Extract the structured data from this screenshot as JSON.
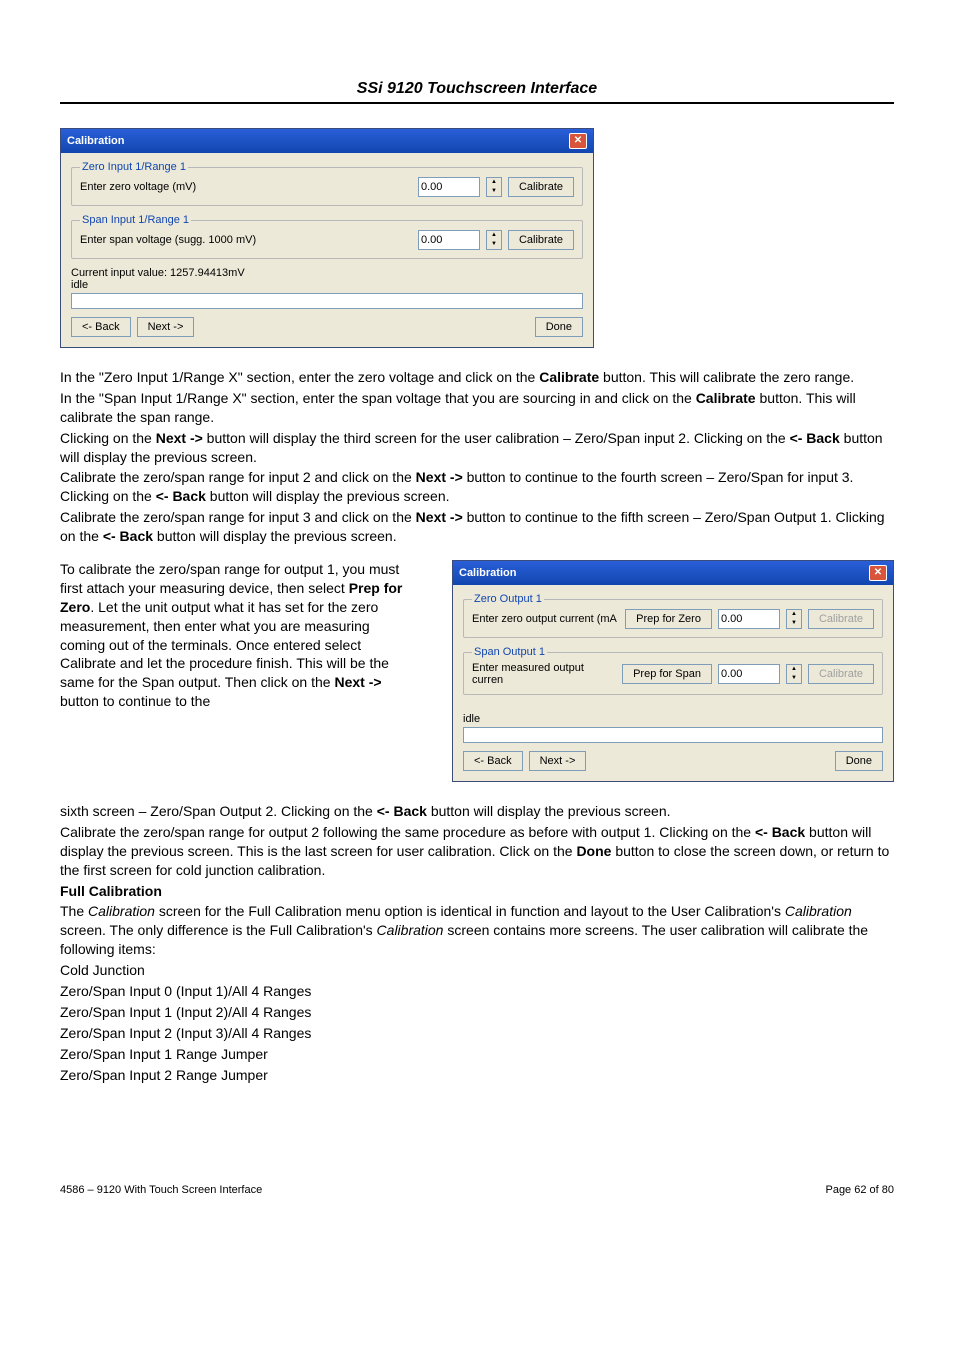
{
  "header": {
    "title": "SSi 9120 Touchscreen Interface"
  },
  "dlg1": {
    "title": "Calibration",
    "zero": {
      "legend": "Zero Input 1/Range 1",
      "label": "Enter zero voltage (mV)",
      "value": "0.00",
      "calibrate": "Calibrate"
    },
    "span": {
      "legend": "Span Input 1/Range 1",
      "label": "Enter span voltage (sugg. 1000 mV)",
      "value": "0.00",
      "calibrate": "Calibrate"
    },
    "current_value_line": "Current input value: 1257.94413mV",
    "idle": "idle",
    "back": "<- Back",
    "next": "Next ->",
    "done": "Done"
  },
  "para1": {
    "l1a": "In the \"Zero Input 1/Range X\" section, enter the zero voltage and click on the ",
    "l1b": "Calibrate",
    "l1c": " button. This will calibrate the zero range.",
    "l2a": "In the \"Span Input 1/Range X\" section, enter the span voltage that you are sourcing in and click on the ",
    "l2b": "Calibrate",
    "l2c": " button.  This will calibrate the span range.",
    "l3a": "Clicking on the ",
    "l3b": "Next ->",
    "l3c": " button will display the third screen for the user calibration – Zero/Span input 2.  Clicking on the ",
    "l3d": "<- Back",
    "l3e": " button will display the previous screen.",
    "l4a": "Calibrate the zero/span range for input 2 and click on the ",
    "l4b": "Next ->",
    "l4c": " button to continue to the fourth screen – Zero/Span for input 3.  Clicking on the ",
    "l4d": "<- Back",
    "l4e": " button will display the previous screen.",
    "l5a": "Calibrate the zero/span range for input 3 and click on the ",
    "l5b": "Next ->",
    "l5c": " button to continue to the fifth screen – Zero/Span Output 1.  Clicking on the ",
    "l5d": "<- Back",
    "l5e": " button will display the previous screen."
  },
  "left_col": {
    "t1": "To calibrate the zero/span range for output 1, you must first attach your measuring device, then select ",
    "t2": "Prep for Zero",
    "t3": ".  Let the unit output what it has set for the zero measurement, then enter what you are measuring coming out of the terminals. Once entered select Calibrate and let the procedure finish.  This will be the same for the Span output.  Then click on the ",
    "t4": "Next ->",
    "t5": " button to continue to the"
  },
  "dlg2": {
    "title": "Calibration",
    "zero": {
      "legend": "Zero Output 1",
      "label": "Enter zero output current (mA",
      "prep": "Prep for Zero",
      "value": "0.00",
      "calibrate": "Calibrate"
    },
    "span": {
      "legend": "Span Output 1",
      "label": "Enter measured output curren",
      "prep": "Prep for Span",
      "value": "0.00",
      "calibrate": "Calibrate"
    },
    "idle": "idle",
    "back": "<- Back",
    "next": "Next ->",
    "done": "Done"
  },
  "after_col": {
    "l1a": "sixth screen – Zero/Span Output 2.  Clicking on the ",
    "l1b": "<- Back",
    "l1c": " button will display the previous screen.",
    "l2a": "Calibrate the zero/span range for output 2 following the same procedure as before with output 1.  Clicking on the ",
    "l2b": "<- Back",
    "l2c": " button will display the previous screen.  This is the last screen for user calibration.  Click on the ",
    "l2d": "Done",
    "l2e": " button to close the screen down, or return to the first screen for cold junction calibration."
  },
  "fullcal": {
    "heading": "Full Calibration",
    "p1a": "The ",
    "p1b": "Calibration",
    "p1c": " screen for the Full Calibration menu option is identical in function and layout to the User Calibration's ",
    "p1d": "Calibration",
    "p1e": " screen.  The only difference is the Full Calibration's ",
    "p1f": "Calibration",
    "p1g": " screen contains more screens.  The user calibration will calibrate the following items:",
    "items": [
      "Cold Junction",
      "Zero/Span Input 0 (Input 1)/All 4 Ranges",
      "Zero/Span Input 1 (Input 2)/All 4 Ranges",
      "Zero/Span Input 2 (Input 3)/All 4 Ranges",
      "Zero/Span Input 1 Range Jumper",
      "Zero/Span Input 2 Range Jumper"
    ]
  },
  "footer": {
    "left": "4586 – 9120 With Touch Screen Interface",
    "right": "Page 62 of 80"
  }
}
